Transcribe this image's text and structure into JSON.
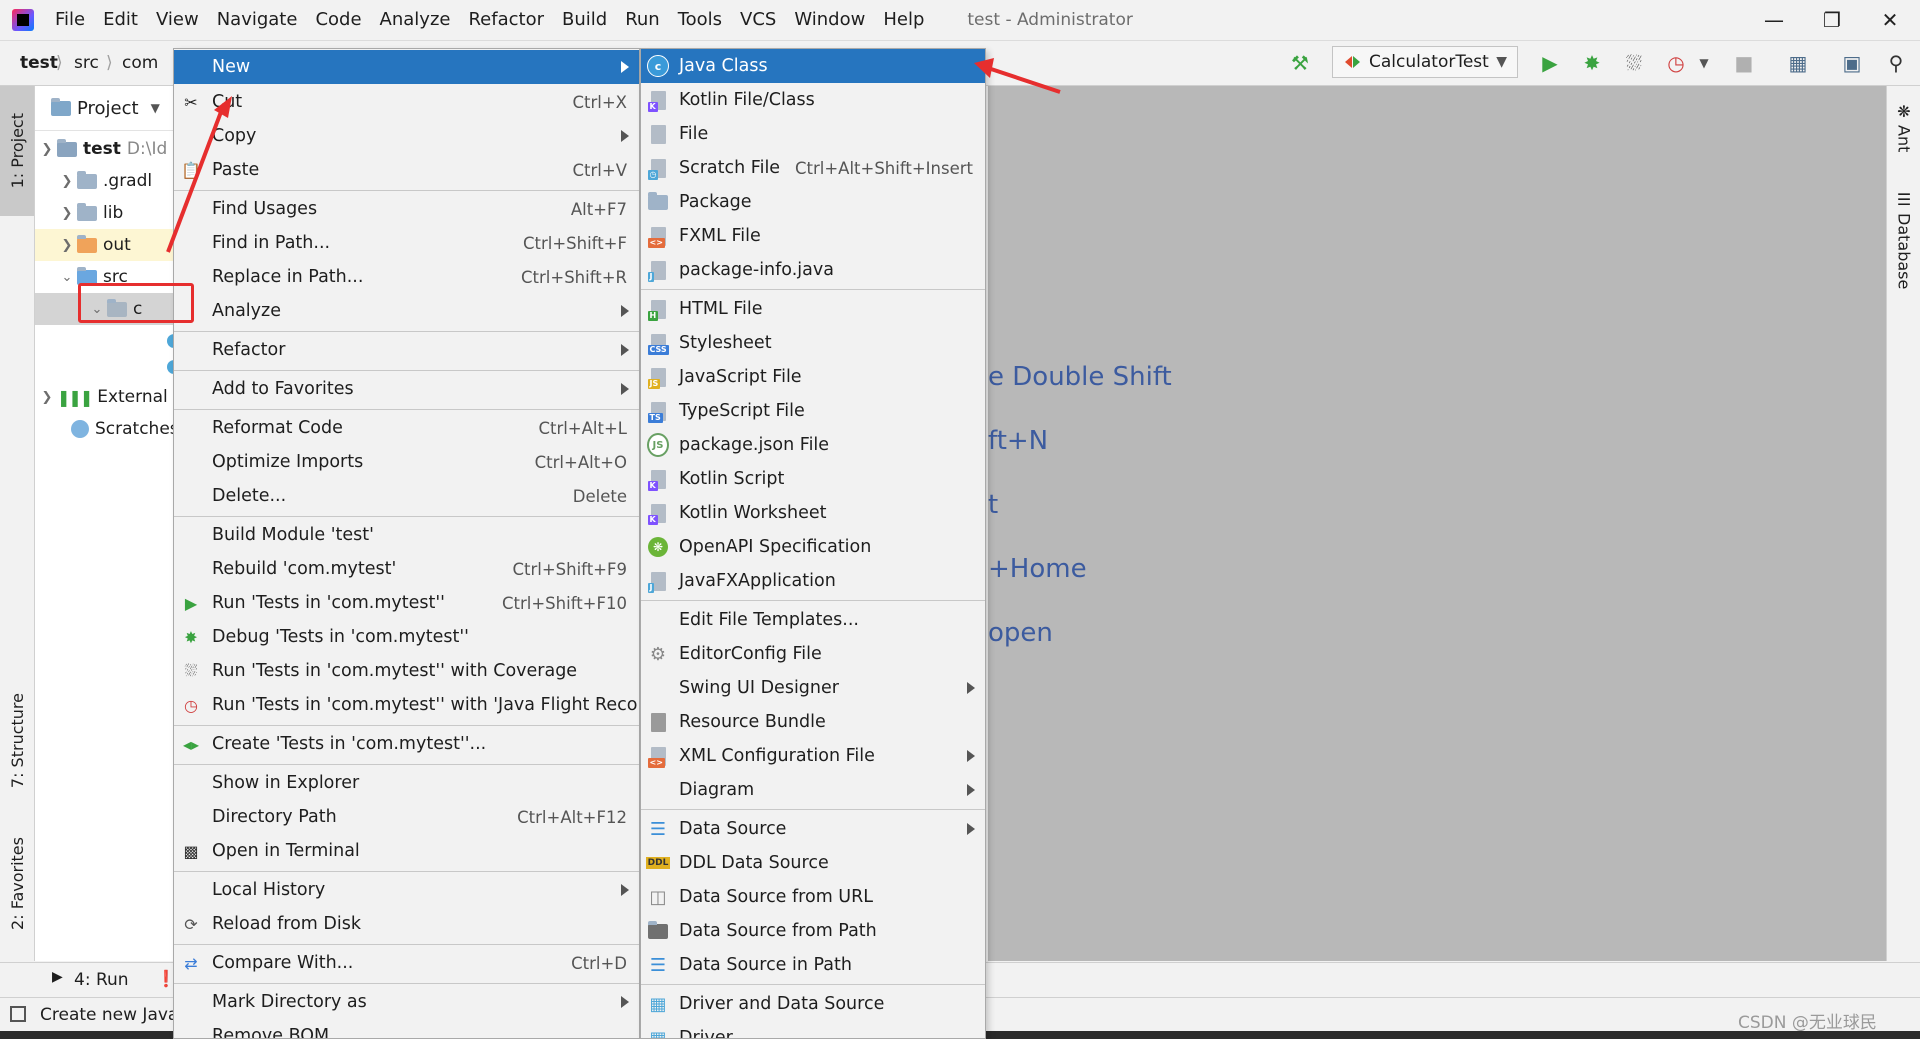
{
  "menubar": {
    "items": [
      "File",
      "Edit",
      "View",
      "Navigate",
      "Code",
      "Analyze",
      "Refactor",
      "Build",
      "Run",
      "Tools",
      "VCS",
      "Window",
      "Help"
    ],
    "window_title": "test - Administrator"
  },
  "breadcrumb": [
    "test",
    "src",
    "com"
  ],
  "toolbar": {
    "run_config": "CalculatorTest"
  },
  "left_tabs": {
    "project": "1: Project",
    "structure": "7: Structure",
    "favorites": "2: Favorites"
  },
  "right_tabs": {
    "ant": "Ant",
    "database": "Database"
  },
  "project_panel": {
    "header": "Project",
    "tree": [
      {
        "label": "test",
        "suffix": "D:\\Id"
      },
      {
        "label": ".gradl"
      },
      {
        "label": "lib"
      },
      {
        "label": "out"
      },
      {
        "label": "src"
      },
      {
        "label": "c"
      },
      {
        "label": "External L"
      },
      {
        "label": "Scratches"
      }
    ]
  },
  "editor_hints": [
    "e Double Shift",
    "ft+N",
    "t",
    "+Home",
    "open"
  ],
  "main_menu": [
    {
      "label": "New",
      "shortcut": "",
      "submenu": true
    },
    {
      "label": "Cut",
      "shortcut": "Ctrl+X"
    },
    {
      "label": "Copy",
      "shortcut": "",
      "submenu": true
    },
    {
      "label": "Paste",
      "shortcut": "Ctrl+V"
    },
    {
      "label": "Find Usages",
      "shortcut": "Alt+F7"
    },
    {
      "label": "Find in Path...",
      "shortcut": "Ctrl+Shift+F"
    },
    {
      "label": "Replace in Path...",
      "shortcut": "Ctrl+Shift+R"
    },
    {
      "label": "Analyze",
      "shortcut": "",
      "submenu": true
    },
    {
      "label": "Refactor",
      "shortcut": "",
      "submenu": true
    },
    {
      "label": "Add to Favorites",
      "shortcut": "",
      "submenu": true
    },
    {
      "label": "Reformat Code",
      "shortcut": "Ctrl+Alt+L"
    },
    {
      "label": "Optimize Imports",
      "shortcut": "Ctrl+Alt+O"
    },
    {
      "label": "Delete...",
      "shortcut": "Delete"
    },
    {
      "label": "Build Module 'test'",
      "shortcut": ""
    },
    {
      "label": "Rebuild 'com.mytest'",
      "shortcut": "Ctrl+Shift+F9"
    },
    {
      "label": "Run 'Tests in 'com.mytest''",
      "shortcut": "Ctrl+Shift+F10"
    },
    {
      "label": "Debug 'Tests in 'com.mytest''",
      "shortcut": ""
    },
    {
      "label": "Run 'Tests in 'com.mytest'' with Coverage",
      "shortcut": ""
    },
    {
      "label": "Run 'Tests in 'com.mytest'' with 'Java Flight Recorder'",
      "shortcut": ""
    },
    {
      "label": "Create 'Tests in 'com.mytest''...",
      "shortcut": ""
    },
    {
      "label": "Show in Explorer",
      "shortcut": ""
    },
    {
      "label": "Directory Path",
      "shortcut": "Ctrl+Alt+F12"
    },
    {
      "label": "Open in Terminal",
      "shortcut": ""
    },
    {
      "label": "Local History",
      "shortcut": "",
      "submenu": true
    },
    {
      "label": "Reload from Disk",
      "shortcut": ""
    },
    {
      "label": "Compare With...",
      "shortcut": "Ctrl+D"
    },
    {
      "label": "Mark Directory as",
      "shortcut": "",
      "submenu": true
    },
    {
      "label": "Remove BOM",
      "shortcut": ""
    }
  ],
  "new_menu": [
    {
      "label": "Java Class",
      "shortcut": ""
    },
    {
      "label": "Kotlin File/Class",
      "shortcut": ""
    },
    {
      "label": "File",
      "shortcut": ""
    },
    {
      "label": "Scratch File",
      "shortcut": "Ctrl+Alt+Shift+Insert"
    },
    {
      "label": "Package",
      "shortcut": ""
    },
    {
      "label": "FXML File",
      "shortcut": ""
    },
    {
      "label": "package-info.java",
      "shortcut": ""
    },
    {
      "label": "HTML File",
      "shortcut": ""
    },
    {
      "label": "Stylesheet",
      "shortcut": ""
    },
    {
      "label": "JavaScript File",
      "shortcut": ""
    },
    {
      "label": "TypeScript File",
      "shortcut": ""
    },
    {
      "label": "package.json File",
      "shortcut": ""
    },
    {
      "label": "Kotlin Script",
      "shortcut": ""
    },
    {
      "label": "Kotlin Worksheet",
      "shortcut": ""
    },
    {
      "label": "OpenAPI Specification",
      "shortcut": ""
    },
    {
      "label": "JavaFXApplication",
      "shortcut": ""
    },
    {
      "label": "Edit File Templates...",
      "shortcut": ""
    },
    {
      "label": "EditorConfig File",
      "shortcut": ""
    },
    {
      "label": "Swing UI Designer",
      "shortcut": "",
      "submenu": true
    },
    {
      "label": "Resource Bundle",
      "shortcut": ""
    },
    {
      "label": "XML Configuration File",
      "shortcut": "",
      "submenu": true
    },
    {
      "label": "Diagram",
      "shortcut": "",
      "submenu": true
    },
    {
      "label": "Data Source",
      "shortcut": "",
      "submenu": true
    },
    {
      "label": "DDL Data Source",
      "shortcut": ""
    },
    {
      "label": "Data Source from URL",
      "shortcut": ""
    },
    {
      "label": "Data Source from Path",
      "shortcut": ""
    },
    {
      "label": "Data Source in Path",
      "shortcut": ""
    },
    {
      "label": "Driver and Data Source",
      "shortcut": ""
    },
    {
      "label": "Driver",
      "shortcut": ""
    }
  ],
  "bottom_tabs": {
    "run": "4: Run"
  },
  "status": {
    "text": "Create new Java"
  },
  "watermark": "CSDN @无业球民 ",
  "colors": {
    "selection": "#2675bf",
    "annotation": "#e62e2e",
    "editor_bg": "#b8b8b8",
    "hint_text": "#3c5b9f"
  }
}
